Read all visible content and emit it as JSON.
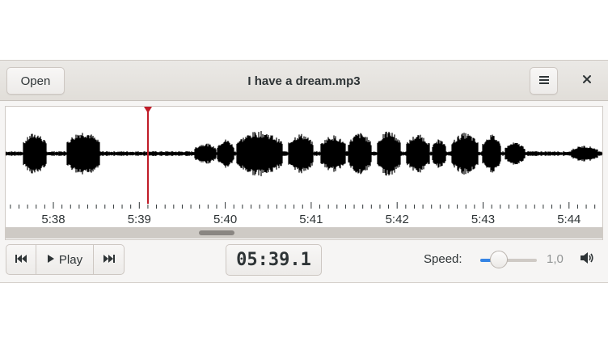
{
  "window": {
    "title": "I have a dream.mp3"
  },
  "headerbar": {
    "open_label": "Open",
    "menu_icon": "hamburger-menu-icon",
    "close_icon": "close-icon"
  },
  "waveform": {
    "time_labels": [
      "5:38",
      "5:39",
      "5:40",
      "5:41",
      "5:42",
      "5:43",
      "5:44"
    ],
    "playhead_color": "#c01c28",
    "playhead_time": "5:39.1",
    "wave_color": "#000000"
  },
  "controls": {
    "prev_icon": "skip-backward-icon",
    "play_label": "Play",
    "play_icon": "play-icon",
    "next_icon": "skip-forward-icon",
    "time_display": "05:39.1",
    "speed_label": "Speed:",
    "speed_value": "1,0",
    "speed_slider_fraction": 0.33,
    "volume_icon": "speaker-volume-icon",
    "accent_color": "#3584e4"
  }
}
